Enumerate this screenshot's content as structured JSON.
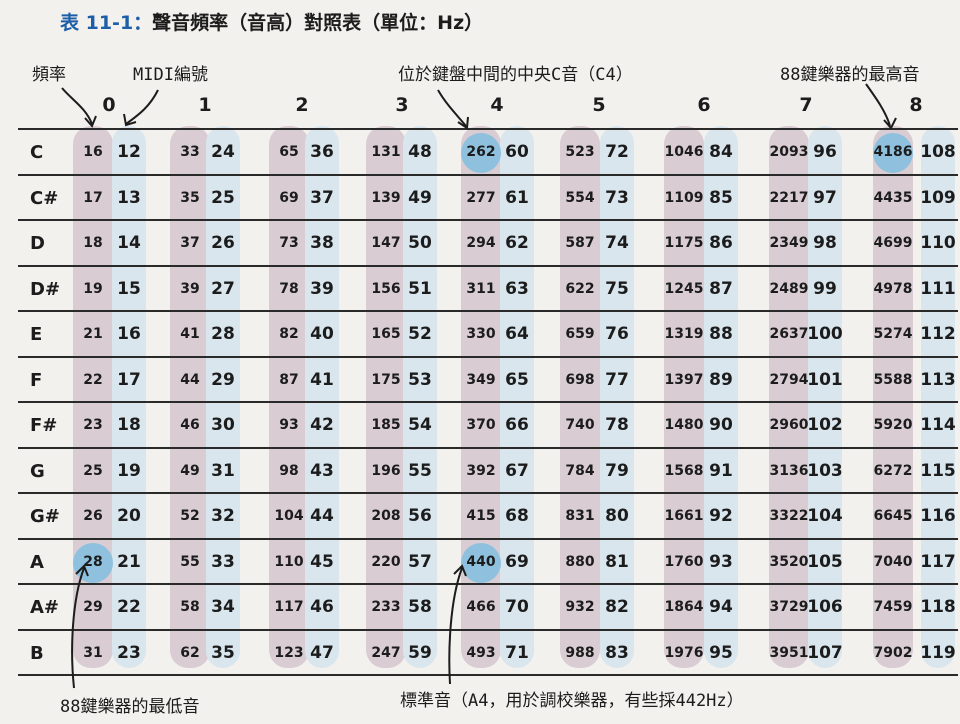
{
  "title": {
    "label": "表 11-1：",
    "text": "聲音頻率（音高）對照表（單位：Hz）"
  },
  "annotations": {
    "frequency": "頻率",
    "midi": "MIDI編號",
    "middle_c": "位於鍵盤中間的中央C音（C4）",
    "highest": "88鍵樂器的最高音",
    "lowest": "88鍵樂器的最低音",
    "standard": "標準音（A4，用於調校樂器，有些採442Hz）"
  },
  "octaves": [
    "0",
    "1",
    "2",
    "3",
    "4",
    "5",
    "6",
    "7",
    "8"
  ],
  "notes": [
    "C",
    "C#",
    "D",
    "D#",
    "E",
    "F",
    "F#",
    "G",
    "G#",
    "A",
    "A#",
    "B"
  ],
  "frequencies": [
    [
      16,
      33,
      65,
      131,
      262,
      523,
      1046,
      2093,
      4186
    ],
    [
      17,
      35,
      69,
      139,
      277,
      554,
      1109,
      2217,
      4435
    ],
    [
      18,
      37,
      73,
      147,
      294,
      587,
      1175,
      2349,
      4699
    ],
    [
      19,
      39,
      78,
      156,
      311,
      622,
      1245,
      2489,
      4978
    ],
    [
      21,
      41,
      82,
      165,
      330,
      659,
      1319,
      2637,
      5274
    ],
    [
      22,
      44,
      87,
      175,
      349,
      698,
      1397,
      2794,
      5588
    ],
    [
      23,
      46,
      93,
      185,
      370,
      740,
      1480,
      2960,
      5920
    ],
    [
      25,
      49,
      98,
      196,
      392,
      784,
      1568,
      3136,
      6272
    ],
    [
      26,
      52,
      104,
      208,
      415,
      831,
      1661,
      3322,
      6645
    ],
    [
      28,
      55,
      110,
      220,
      440,
      880,
      1760,
      3520,
      7040
    ],
    [
      29,
      58,
      117,
      233,
      466,
      932,
      1864,
      3729,
      7459
    ],
    [
      31,
      62,
      123,
      247,
      493,
      988,
      1976,
      3951,
      7902
    ]
  ],
  "midi": [
    [
      12,
      24,
      36,
      48,
      60,
      72,
      84,
      96,
      108
    ],
    [
      13,
      25,
      37,
      49,
      61,
      73,
      85,
      97,
      109
    ],
    [
      14,
      26,
      38,
      50,
      62,
      74,
      86,
      98,
      110
    ],
    [
      15,
      27,
      39,
      51,
      63,
      75,
      87,
      99,
      111
    ],
    [
      16,
      28,
      40,
      52,
      64,
      76,
      88,
      100,
      112
    ],
    [
      17,
      29,
      41,
      53,
      65,
      77,
      89,
      101,
      113
    ],
    [
      18,
      30,
      42,
      54,
      66,
      78,
      90,
      102,
      114
    ],
    [
      19,
      31,
      43,
      55,
      67,
      79,
      91,
      103,
      115
    ],
    [
      20,
      32,
      44,
      56,
      68,
      80,
      92,
      104,
      116
    ],
    [
      21,
      33,
      45,
      57,
      69,
      81,
      93,
      105,
      117
    ],
    [
      22,
      34,
      46,
      58,
      70,
      82,
      94,
      106,
      118
    ],
    [
      23,
      35,
      47,
      59,
      71,
      83,
      95,
      107,
      119
    ]
  ],
  "highlight_color": "#8fc1df"
}
